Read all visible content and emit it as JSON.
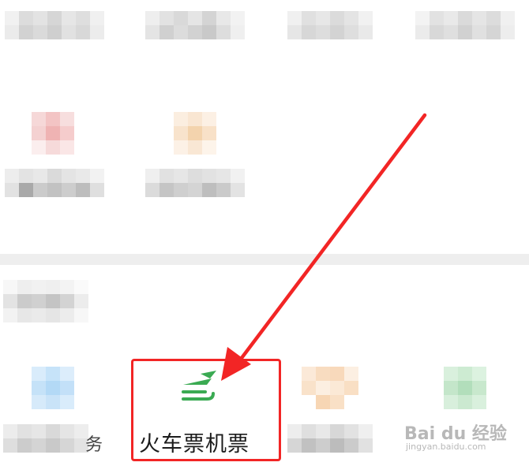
{
  "highlighted_item": {
    "label": "火车票机票",
    "icon": "train-plane-icon",
    "icon_color": "#3aaa52"
  },
  "partial_text": "务",
  "annotation": {
    "box_color": "#f22525",
    "arrow_color": "#f22525"
  },
  "watermark": {
    "brand": "Bai du 经验",
    "url": "jingyan.baidu.com"
  }
}
